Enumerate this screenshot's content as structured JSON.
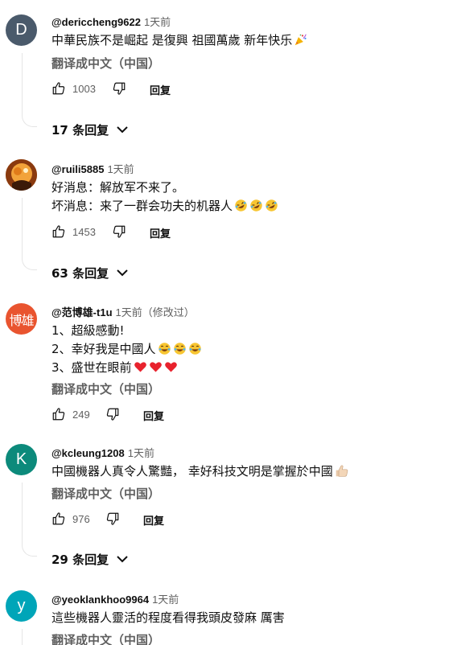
{
  "comments": [
    {
      "author": "@dericcheng9622",
      "time": "1天前",
      "avatar_letter": "D",
      "avatar_color": "#4a5a6b",
      "lines": [
        "中華民族不是崛起 是復興 祖國萬歲 新年快乐"
      ],
      "line_emojis": [
        [
          "party-popper"
        ]
      ],
      "translate": "翻译成中文（中国）",
      "likes": "1003",
      "reply_label": "回复",
      "replies": "17 条回复"
    },
    {
      "author": "@ruili5885",
      "time": "1天前",
      "avatar_letter": "",
      "avatar_color": "#c26a1a",
      "lines": [
        "好消息：解放军不来了。",
        "坏消息：来了一群会功夫的机器人"
      ],
      "line_emojis": [
        [],
        [
          "rofl",
          "rofl",
          "rofl"
        ]
      ],
      "likes": "1453",
      "reply_label": "回复",
      "replies": "63 条回复"
    },
    {
      "author": "@范博雄-t1u",
      "time": "1天前（修改过）",
      "avatar_letter": "博雄",
      "avatar_color": "#e9542f",
      "lines": [
        "1、超級感動!",
        "2、幸好我是中國人",
        "3、盛世在眼前"
      ],
      "line_emojis": [
        [],
        [
          "tears-of-joy",
          "tears-of-joy",
          "tears-of-joy"
        ],
        [
          "red-heart",
          "red-heart",
          "red-heart"
        ]
      ],
      "translate": "翻译成中文（中国）",
      "likes": "249",
      "reply_label": "回复"
    },
    {
      "author": "@kcleung1208",
      "time": "1天前",
      "avatar_letter": "K",
      "avatar_color": "#0c8a7b",
      "lines": [
        "中國機器人真令人驚豔，  幸好科技文明是掌握於中國"
      ],
      "line_emojis": [
        [
          "thumbs-up"
        ]
      ],
      "translate": "翻译成中文（中国）",
      "likes": "976",
      "reply_label": "回复",
      "replies": "29 条回复"
    },
    {
      "author": "@yeoklankhoo9964",
      "time": "1天前",
      "avatar_letter": "y",
      "avatar_color": "#00a5b8",
      "lines": [
        "這些機器人靈活的程度看得我頭皮發麻    厲害"
      ],
      "line_emojis": [
        []
      ],
      "translate": "翻译成中文（中国）"
    }
  ]
}
